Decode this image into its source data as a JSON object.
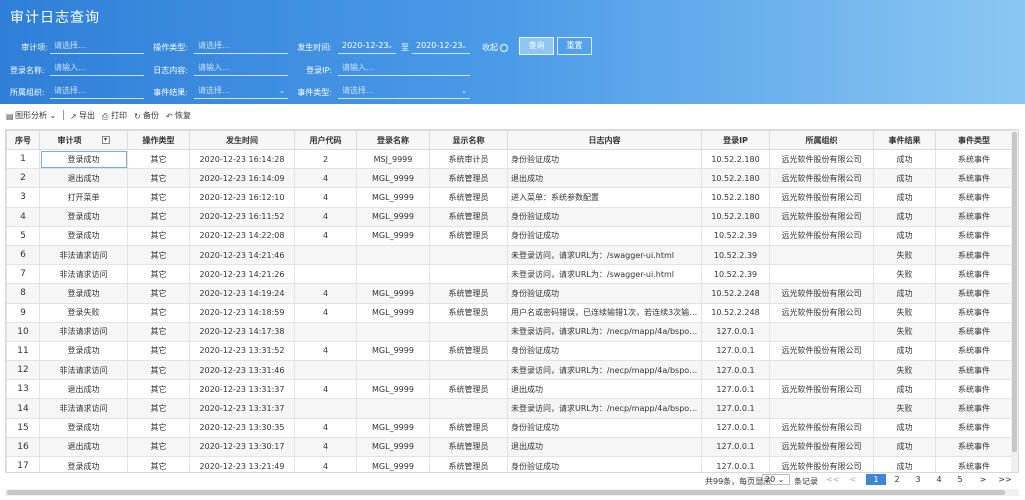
{
  "title": "审计日志查询",
  "filters": {
    "audit_item": {
      "label": "审计项:",
      "placeholder": "请选择..."
    },
    "op_type": {
      "label": "操作类型:",
      "placeholder": "请选择..."
    },
    "occur_time": {
      "label": "发生时间:",
      "from": "2020-12-23",
      "to_label": "至",
      "to": "2020-12-23"
    },
    "fold_label": "收起",
    "query_label": "查询",
    "reset_label": "重置",
    "login_name": {
      "label": "登录名称:",
      "placeholder": "请输入..."
    },
    "log_content": {
      "label": "日志内容:",
      "placeholder": "请输入..."
    },
    "login_ip": {
      "label": "登录IP:",
      "placeholder": "请输入..."
    },
    "org": {
      "label": "所属组织:",
      "placeholder": "请选择..."
    },
    "event_result": {
      "label": "事件结果:",
      "placeholder": "请选择..."
    },
    "event_type": {
      "label": "事件类型:",
      "placeholder": "请选择..."
    }
  },
  "toolbar": {
    "chart_label": "图形分析",
    "export_label": "导出",
    "print_label": "打印",
    "backup_label": "备份",
    "restore_label": "恢复"
  },
  "table": {
    "headers": [
      "序号",
      "审计项",
      "操作类型",
      "发生时间",
      "用户代码",
      "登录名称",
      "显示名称",
      "日志内容",
      "登录IP",
      "所属组织",
      "事件结果",
      "事件类型"
    ],
    "rows": [
      [
        "1",
        "登录成功",
        "其它",
        "2020-12-23 16:14:28",
        "2",
        "MSJ_9999",
        "系统审计员",
        "身份验证成功",
        "10.52.2.180",
        "远光软件股份有限公司",
        "成功",
        "系统事件"
      ],
      [
        "2",
        "退出成功",
        "其它",
        "2020-12-23 16:14:09",
        "4",
        "MGL_9999",
        "系统管理员",
        "退出成功",
        "10.52.2.180",
        "远光软件股份有限公司",
        "成功",
        "系统事件"
      ],
      [
        "3",
        "打开菜单",
        "其它",
        "2020-12-23 16:12:10",
        "4",
        "MGL_9999",
        "系统管理员",
        "进入菜单：系统参数配置",
        "10.52.2.180",
        "远光软件股份有限公司",
        "成功",
        "系统事件"
      ],
      [
        "4",
        "登录成功",
        "其它",
        "2020-12-23 16:11:52",
        "4",
        "MGL_9999",
        "系统管理员",
        "身份验证成功",
        "10.52.2.180",
        "远光软件股份有限公司",
        "成功",
        "系统事件"
      ],
      [
        "5",
        "登录成功",
        "其它",
        "2020-12-23 14:22:08",
        "4",
        "MGL_9999",
        "系统管理员",
        "身份验证成功",
        "10.52.2.39",
        "远光软件股份有限公司",
        "成功",
        "系统事件"
      ],
      [
        "6",
        "非法请求访问",
        "其它",
        "2020-12-23 14:21:46",
        "",
        "",
        "",
        "未登录访问，请求URL为：/swagger-ui.html",
        "10.52.2.39",
        "",
        "失败",
        "系统事件"
      ],
      [
        "7",
        "非法请求访问",
        "其它",
        "2020-12-23 14:21:26",
        "",
        "",
        "",
        "未登录访问，请求URL为：/swagger-ui.html",
        "10.52.2.39",
        "",
        "失败",
        "系统事件"
      ],
      [
        "8",
        "登录成功",
        "其它",
        "2020-12-23 14:19:24",
        "4",
        "MGL_9999",
        "系统管理员",
        "身份验证成功",
        "10.52.2.248",
        "远光软件股份有限公司",
        "成功",
        "系统事件"
      ],
      [
        "9",
        "登录失败",
        "其它",
        "2020-12-23 14:18:59",
        "4",
        "MGL_9999",
        "系统管理员",
        "用户名或密码错误，已连续输错1次，若连续3次输错后...",
        "10.52.2.248",
        "远光软件股份有限公司",
        "失败",
        "系统事件"
      ],
      [
        "10",
        "非法请求访问",
        "其它",
        "2020-12-23 14:17:38",
        "",
        "",
        "",
        "未登录访问，请求URL为：/necp/mapp/4a/bsportal/...",
        "127.0.0.1",
        "",
        "失败",
        "系统事件"
      ],
      [
        "11",
        "登录成功",
        "其它",
        "2020-12-23 13:31:52",
        "4",
        "MGL_9999",
        "系统管理员",
        "身份验证成功",
        "127.0.0.1",
        "远光软件股份有限公司",
        "成功",
        "系统事件"
      ],
      [
        "12",
        "非法请求访问",
        "其它",
        "2020-12-23 13:31:46",
        "",
        "",
        "",
        "未登录访问，请求URL为：/necp/mapp/4a/bsportal/...",
        "127.0.0.1",
        "",
        "失败",
        "系统事件"
      ],
      [
        "13",
        "退出成功",
        "其它",
        "2020-12-23 13:31:37",
        "4",
        "MGL_9999",
        "系统管理员",
        "退出成功",
        "127.0.0.1",
        "远光软件股份有限公司",
        "成功",
        "系统事件"
      ],
      [
        "14",
        "非法请求访问",
        "其它",
        "2020-12-23 13:31:37",
        "",
        "",
        "",
        "未登录访问，请求URL为：/necp/mapp/4a/bsportal/...",
        "127.0.0.1",
        "",
        "失败",
        "系统事件"
      ],
      [
        "15",
        "登录成功",
        "其它",
        "2020-12-23 13:30:35",
        "4",
        "MGL_9999",
        "系统管理员",
        "身份验证成功",
        "127.0.0.1",
        "远光软件股份有限公司",
        "成功",
        "系统事件"
      ],
      [
        "16",
        "退出成功",
        "其它",
        "2020-12-23 13:30:17",
        "4",
        "MGL_9999",
        "系统管理员",
        "退出成功",
        "127.0.0.1",
        "远光软件股份有限公司",
        "成功",
        "系统事件"
      ],
      [
        "17",
        "登录成功",
        "其它",
        "2020-12-23 13:21:49",
        "4",
        "MGL_9999",
        "系统管理员",
        "身份验证成功",
        "127.0.0.1",
        "远光软件股份有限公司",
        "成功",
        "系统事件"
      ]
    ]
  },
  "pager": {
    "total": "共99条，每页显示",
    "page_size": "20",
    "unit": "条记录",
    "first": "<<",
    "prev": "<",
    "pages": [
      "1",
      "2",
      "3",
      "4",
      "5"
    ],
    "current": "1",
    "next": ">",
    "last": ">>"
  }
}
